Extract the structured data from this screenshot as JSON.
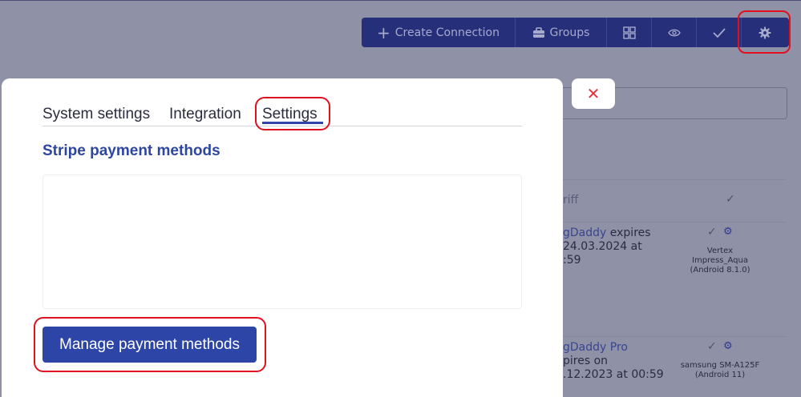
{
  "toolbar": {
    "create_label": "Create Connection",
    "groups_label": "Groups",
    "icons": [
      "plus-icon",
      "briefcase-icon",
      "grid-icon",
      "eye-icon",
      "check-icon",
      "gear-icon"
    ]
  },
  "background": {
    "column_header_partial": "riff",
    "rows": [
      {
        "tariff_link": "gDaddy",
        "tariff_suffix": " expires",
        "line2": "24.03.2024 at",
        "line3": ":59",
        "device_line1": "Vertex",
        "device_line2": "Impress_Aqua",
        "device_line3": "(Android 8.1.0)"
      },
      {
        "tariff_link": "gDaddy Pro",
        "line2": "pires on",
        "line3": ".12.2023 at 00:59",
        "device_line1": "samsung SM-A125F",
        "device_line2": "(Android 11)"
      }
    ]
  },
  "close_button": {
    "symbol": "✕"
  },
  "modal": {
    "tabs": [
      {
        "label": "System settings"
      },
      {
        "label": "Integration"
      },
      {
        "label": "Settings",
        "active": true
      }
    ],
    "section_title": "Stripe payment methods",
    "manage_button_label": "Manage payment methods"
  },
  "colors": {
    "overlay": "#8f91a6",
    "primary": "#2e45a8",
    "highlight": "#e0101f",
    "close_icon": "#e3343f"
  }
}
